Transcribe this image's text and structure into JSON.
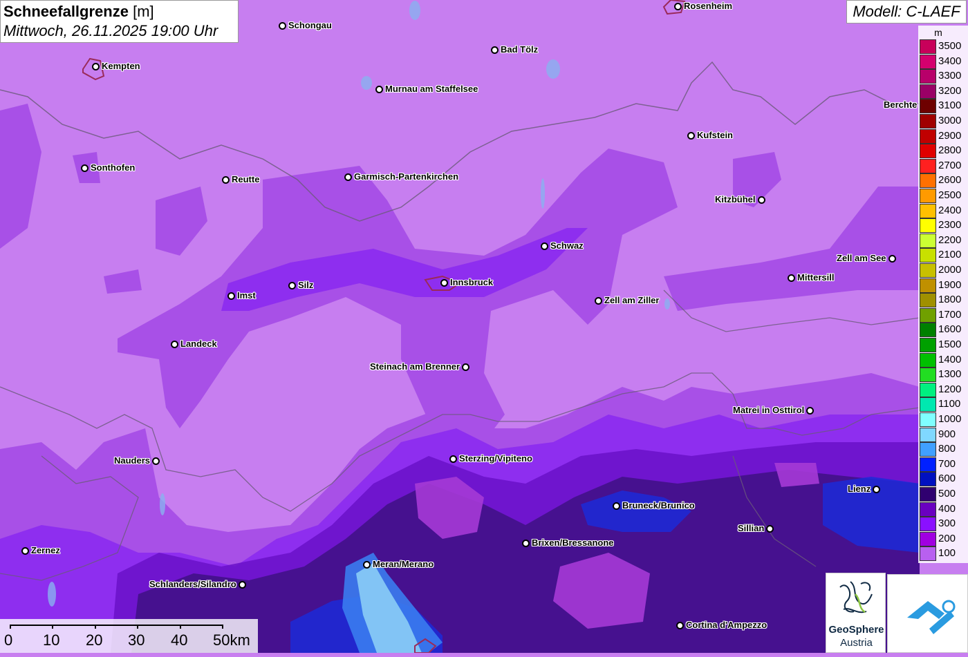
{
  "title": {
    "main": "Schneefallgrenze",
    "unit": "[m]",
    "datetime": "Mittwoch, 26.11.2025 19:00 Uhr"
  },
  "model": "Modell: C-LAEF",
  "legend": {
    "unit": "m",
    "items": [
      {
        "label": "3500",
        "color": "#c8005a"
      },
      {
        "label": "3400",
        "color": "#d4006e"
      },
      {
        "label": "3300",
        "color": "#b8006a"
      },
      {
        "label": "3200",
        "color": "#9a0066"
      },
      {
        "label": "3100",
        "color": "#6e0000"
      },
      {
        "label": "3000",
        "color": "#a00000"
      },
      {
        "label": "2900",
        "color": "#c00000"
      },
      {
        "label": "2800",
        "color": "#e00000"
      },
      {
        "label": "2700",
        "color": "#ff2020"
      },
      {
        "label": "2600",
        "color": "#ff7000"
      },
      {
        "label": "2500",
        "color": "#ff9a00"
      },
      {
        "label": "2400",
        "color": "#ffc000"
      },
      {
        "label": "2300",
        "color": "#ffff00"
      },
      {
        "label": "2200",
        "color": "#ccff33"
      },
      {
        "label": "2100",
        "color": "#c8e000"
      },
      {
        "label": "2000",
        "color": "#c8c000"
      },
      {
        "label": "1900",
        "color": "#c09000"
      },
      {
        "label": "1800",
        "color": "#a09000"
      },
      {
        "label": "1700",
        "color": "#70a000"
      },
      {
        "label": "1600",
        "color": "#008000"
      },
      {
        "label": "1500",
        "color": "#00a000"
      },
      {
        "label": "1400",
        "color": "#00c000"
      },
      {
        "label": "1300",
        "color": "#22dd22"
      },
      {
        "label": "1200",
        "color": "#00f080"
      },
      {
        "label": "1100",
        "color": "#00e8b0"
      },
      {
        "label": "1000",
        "color": "#80ffff"
      },
      {
        "label": "900",
        "color": "#80d8ff"
      },
      {
        "label": "800",
        "color": "#40a0ff"
      },
      {
        "label": "700",
        "color": "#0020ff"
      },
      {
        "label": "600",
        "color": "#0010c0"
      },
      {
        "label": "500",
        "color": "#300070"
      },
      {
        "label": "400",
        "color": "#6a00c0"
      },
      {
        "label": "300",
        "color": "#8a10ff"
      },
      {
        "label": "200",
        "color": "#a000e0"
      },
      {
        "label": "100",
        "color": "#b860f0"
      }
    ]
  },
  "scale": {
    "labels": [
      "0",
      "10",
      "20",
      "30",
      "40",
      "50km"
    ]
  },
  "logos": {
    "geosphere_line1": "GeoSphere",
    "geosphere_line2": "Austria"
  },
  "cities": [
    {
      "name": "Rosenheim",
      "anchor": "right"
    },
    {
      "name": "Schongau",
      "anchor": "right"
    },
    {
      "name": "Kempten",
      "anchor": "right"
    },
    {
      "name": "Bad Tölz",
      "anchor": "right"
    },
    {
      "name": "Murnau am Staffelsee",
      "anchor": "right"
    },
    {
      "name": "Kufstein",
      "anchor": "right"
    },
    {
      "name": "Sonthofen",
      "anchor": "right"
    },
    {
      "name": "Reutte",
      "anchor": "right"
    },
    {
      "name": "Garmisch-Partenkirchen",
      "anchor": "right"
    },
    {
      "name": "Kitzbühel",
      "anchor": "left"
    },
    {
      "name": "Zell am See",
      "anchor": "left"
    },
    {
      "name": "Schwaz",
      "anchor": "right"
    },
    {
      "name": "Mittersill",
      "anchor": "right"
    },
    {
      "name": "Imst",
      "anchor": "right"
    },
    {
      "name": "Silz",
      "anchor": "right"
    },
    {
      "name": "Innsbruck",
      "anchor": "right"
    },
    {
      "name": "Zell am Ziller",
      "anchor": "right"
    },
    {
      "name": "Landeck",
      "anchor": "right"
    },
    {
      "name": "Steinach am Brenner",
      "anchor": "left"
    },
    {
      "name": "Matrei in Osttirol",
      "anchor": "left"
    },
    {
      "name": "Nauders",
      "anchor": "left"
    },
    {
      "name": "Sterzing/Vipiteno",
      "anchor": "right"
    },
    {
      "name": "Lienz",
      "anchor": "left"
    },
    {
      "name": "Bruneck/Brunico",
      "anchor": "right"
    },
    {
      "name": "Sillian",
      "anchor": "left"
    },
    {
      "name": "Brixen/Bressanone",
      "anchor": "right"
    },
    {
      "name": "Zernez",
      "anchor": "right"
    },
    {
      "name": "Meran/Merano",
      "anchor": "right"
    },
    {
      "name": "Schlanders/Silandro",
      "anchor": "left"
    },
    {
      "name": "Cortina d'Ampezzo",
      "anchor": "right"
    },
    {
      "name": "Berchte",
      "anchor": "right"
    }
  ]
}
